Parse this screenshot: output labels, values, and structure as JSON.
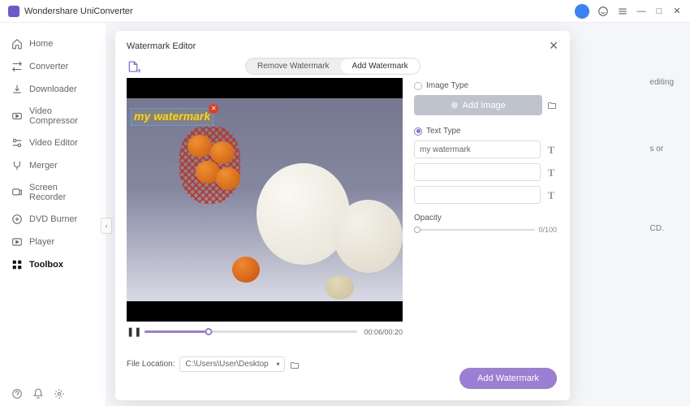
{
  "app": {
    "title": "Wondershare UniConverter"
  },
  "sidebar": {
    "items": [
      {
        "label": "Home"
      },
      {
        "label": "Converter"
      },
      {
        "label": "Downloader"
      },
      {
        "label": "Video Compressor"
      },
      {
        "label": "Video Editor"
      },
      {
        "label": "Merger"
      },
      {
        "label": "Screen Recorder"
      },
      {
        "label": "DVD Burner"
      },
      {
        "label": "Player"
      },
      {
        "label": "Toolbox"
      }
    ]
  },
  "modal": {
    "title": "Watermark Editor",
    "tabs": {
      "remove": "Remove Watermark",
      "add": "Add Watermark"
    },
    "watermark_text": "my watermark",
    "time": "00:06/00:20",
    "file_label": "File Location:",
    "file_path": "C:\\Users\\User\\Desktop",
    "image_section": {
      "label": "Image Type",
      "button": "Add Image"
    },
    "text_section": {
      "label": "Text Type",
      "input1": "my watermark",
      "input2": "",
      "input3": ""
    },
    "opacity": {
      "label": "Opacity",
      "value": "0/100"
    },
    "submit": "Add Watermark"
  },
  "bg_hints": {
    "h1": "editing",
    "h2": "s or",
    "h3": "CD."
  }
}
